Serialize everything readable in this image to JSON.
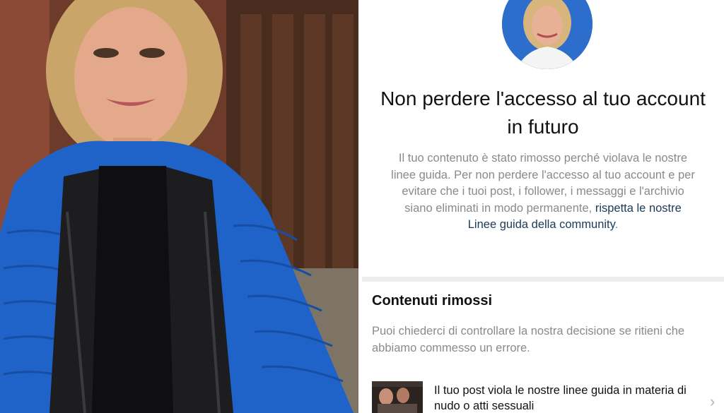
{
  "colors": {
    "link": "#1b3a57",
    "secondary_text": "#8a8a8a",
    "primary_text": "#111111",
    "jacket_blue": "#1f63c8",
    "avatar_bg": "#2d6dcc"
  },
  "notice": {
    "headline": "Non perdere l'accesso al tuo account in futuro",
    "body": "Il tuo contenuto è stato rimosso perché violava le nostre linee guida. Per non perdere l'accesso al tuo account e per evitare che i tuoi post, i follower, i messaggi e l'archivio siano eliminati in modo permanente, ",
    "link_text": "rispetta le nostre Linee guida della community",
    "body_end": "."
  },
  "removed_content": {
    "title": "Contenuti rimossi",
    "description": "Puoi chiederci di controllare la nostra decisione se ritieni che abbiamo commesso un errore.",
    "post": {
      "text": "Il tuo post viola le nostre linee guida in materia di nudo o atti sessuali",
      "chevron_icon": "chevron-right-icon"
    }
  }
}
